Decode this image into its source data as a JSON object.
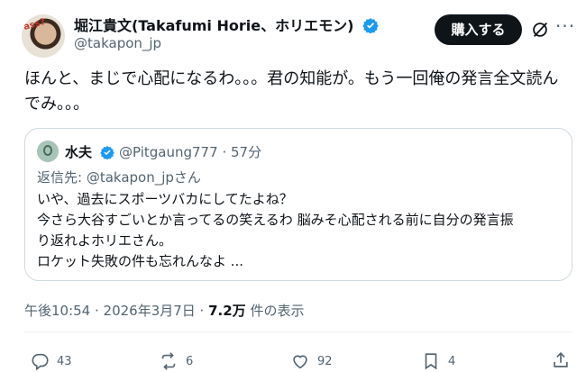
{
  "author": {
    "name": "堀江貴文(Takafumi Horie、ホリエモン)",
    "handle": "@takapon_jp",
    "avatar_text": "ass?"
  },
  "header": {
    "buy_label": "購入する",
    "more_label": "···"
  },
  "post": {
    "text": "ほんと、まじで心配になるわ。。。君の知能が。もう一回俺の発言全文読んでみ。。。"
  },
  "quote": {
    "name": "水夫",
    "handle": "@Pitgaung777",
    "time": "57分",
    "reply_to": "返信先: @takapon_jpさん",
    "lines": [
      "いや、過去にスポーツバカにしてたよね？",
      "今さら大谷すごいとか言ってるの笑えるわ 脳みそ心配される前に自分の発言振",
      "り返れよホリエさん。",
      "ロケット失敗の件も忘れんなよ ..."
    ]
  },
  "meta": {
    "time": "午後10:54 · 2026年3月7日 · ",
    "views": "7.2万",
    "views_label": " 件の表示"
  },
  "actions": {
    "replies": "43",
    "reposts": "6",
    "likes": "92",
    "bookmarks": "4"
  },
  "colors": {
    "verified": "#1d9bf0",
    "text": "#0f1419",
    "muted": "#536471"
  }
}
